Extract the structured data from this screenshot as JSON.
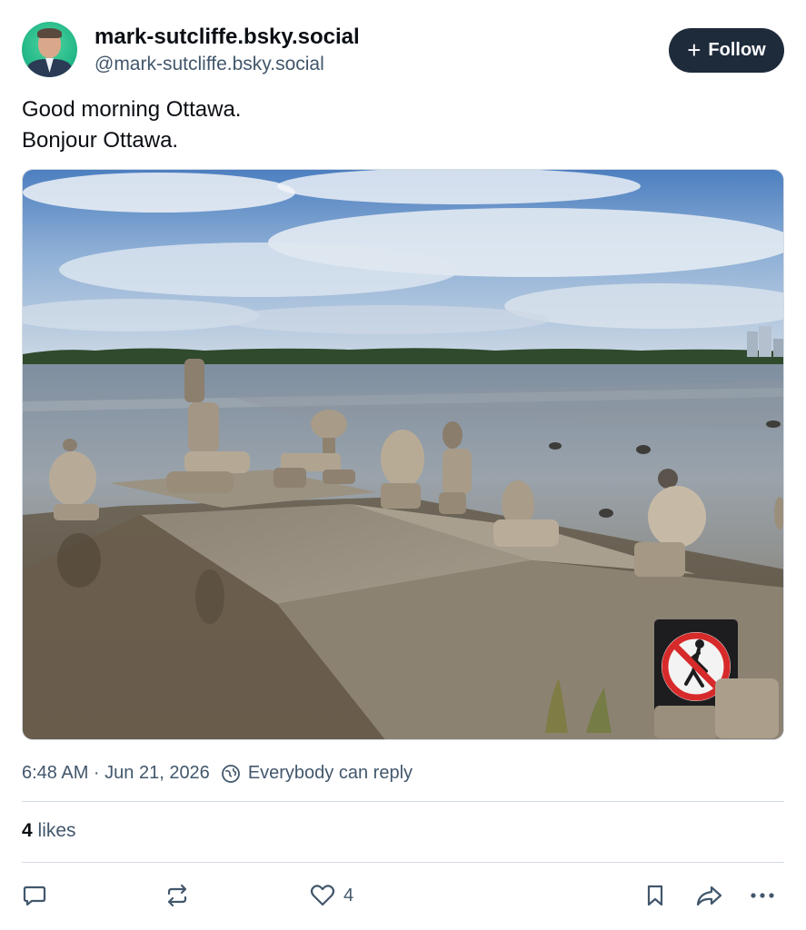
{
  "author": {
    "display_name": "mark-sutcliffe.bsky.social",
    "handle": "@mark-sutcliffe.bsky.social"
  },
  "follow_button": {
    "label": "Follow",
    "icon": "plus-icon"
  },
  "post": {
    "lines": [
      "Good morning Ottawa.",
      "Bonjour Ottawa."
    ]
  },
  "meta": {
    "timestamp": "6:48 AM · Jun 21, 2026",
    "reply_setting": "Everybody can reply",
    "reply_icon": "globe-icon"
  },
  "stats": {
    "likes_count": "4",
    "likes_label": "likes"
  },
  "actions": {
    "reply_icon": "comment-icon",
    "repost_icon": "repost-icon",
    "like_icon": "heart-icon",
    "like_count": "4",
    "bookmark_icon": "bookmark-icon",
    "share_icon": "share-icon",
    "more_icon": "more-icon"
  },
  "colors": {
    "follow_bg": "#1e2b3b",
    "secondary_text": "#42576c",
    "divider": "#d4dbe2"
  }
}
